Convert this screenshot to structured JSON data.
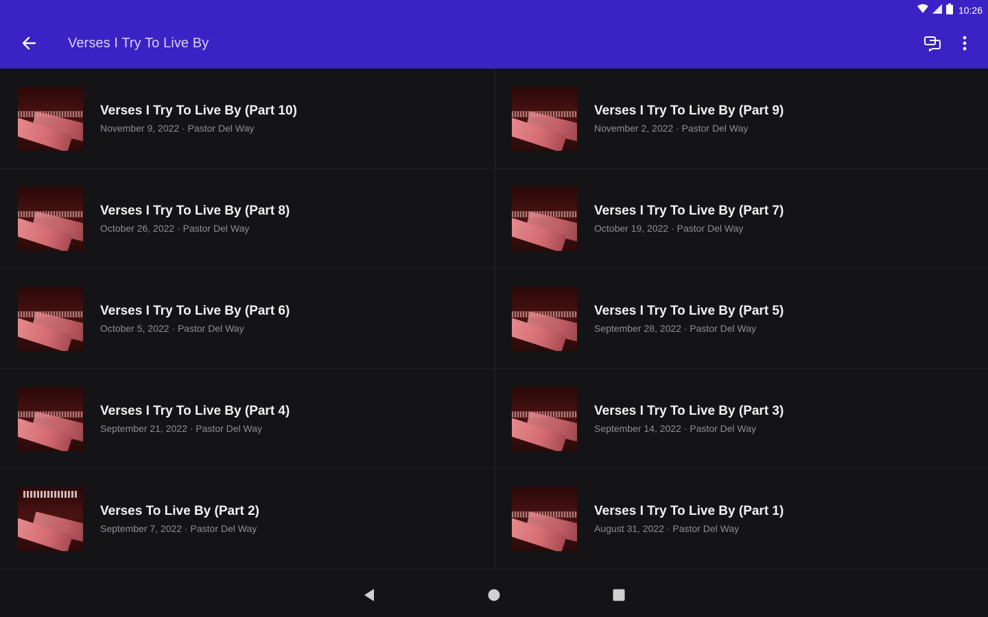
{
  "status_bar": {
    "time": "10:26",
    "icons": [
      "wifi-icon",
      "cell-signal-icon",
      "battery-icon"
    ]
  },
  "app_bar": {
    "title": "Verses I Try To Live By",
    "back_icon": "arrow-back-icon",
    "actions": [
      "chat-icon",
      "more-vert-icon"
    ],
    "background_color": "#3a22c4"
  },
  "sermons": [
    {
      "title": "Verses I Try To Live By (Part 10)",
      "subtitle": "November 9, 2022 · Pastor Del Way"
    },
    {
      "title": "Verses I Try To Live By (Part 9)",
      "subtitle": "November 2, 2022 · Pastor Del Way"
    },
    {
      "title": "Verses I Try To Live By (Part 8)",
      "subtitle": "October 26, 2022 · Pastor Del Way"
    },
    {
      "title": "Verses I Try To Live By (Part 7)",
      "subtitle": "October 19, 2022 · Pastor Del Way"
    },
    {
      "title": "Verses I Try To Live By (Part 6)",
      "subtitle": "October 5, 2022 · Pastor Del Way"
    },
    {
      "title": "Verses I Try To Live By (Part 5)",
      "subtitle": "September 28, 2022 · Pastor Del Way"
    },
    {
      "title": "Verses I Try To Live By (Part 4)",
      "subtitle": "September 21, 2022 · Pastor Del Way"
    },
    {
      "title": "Verses I Try To Live By (Part 3)",
      "subtitle": "September 14, 2022 · Pastor Del Way"
    },
    {
      "title": "Verses To Live By (Part 2)",
      "subtitle": "September 7, 2022 · Pastor Del Way"
    },
    {
      "title": "Verses I Try To Live By (Part 1)",
      "subtitle": "August 31, 2022 · Pastor Del Way"
    }
  ],
  "nav_bar": {
    "icons": [
      "nav-back-icon",
      "nav-home-icon",
      "nav-recents-icon"
    ]
  }
}
